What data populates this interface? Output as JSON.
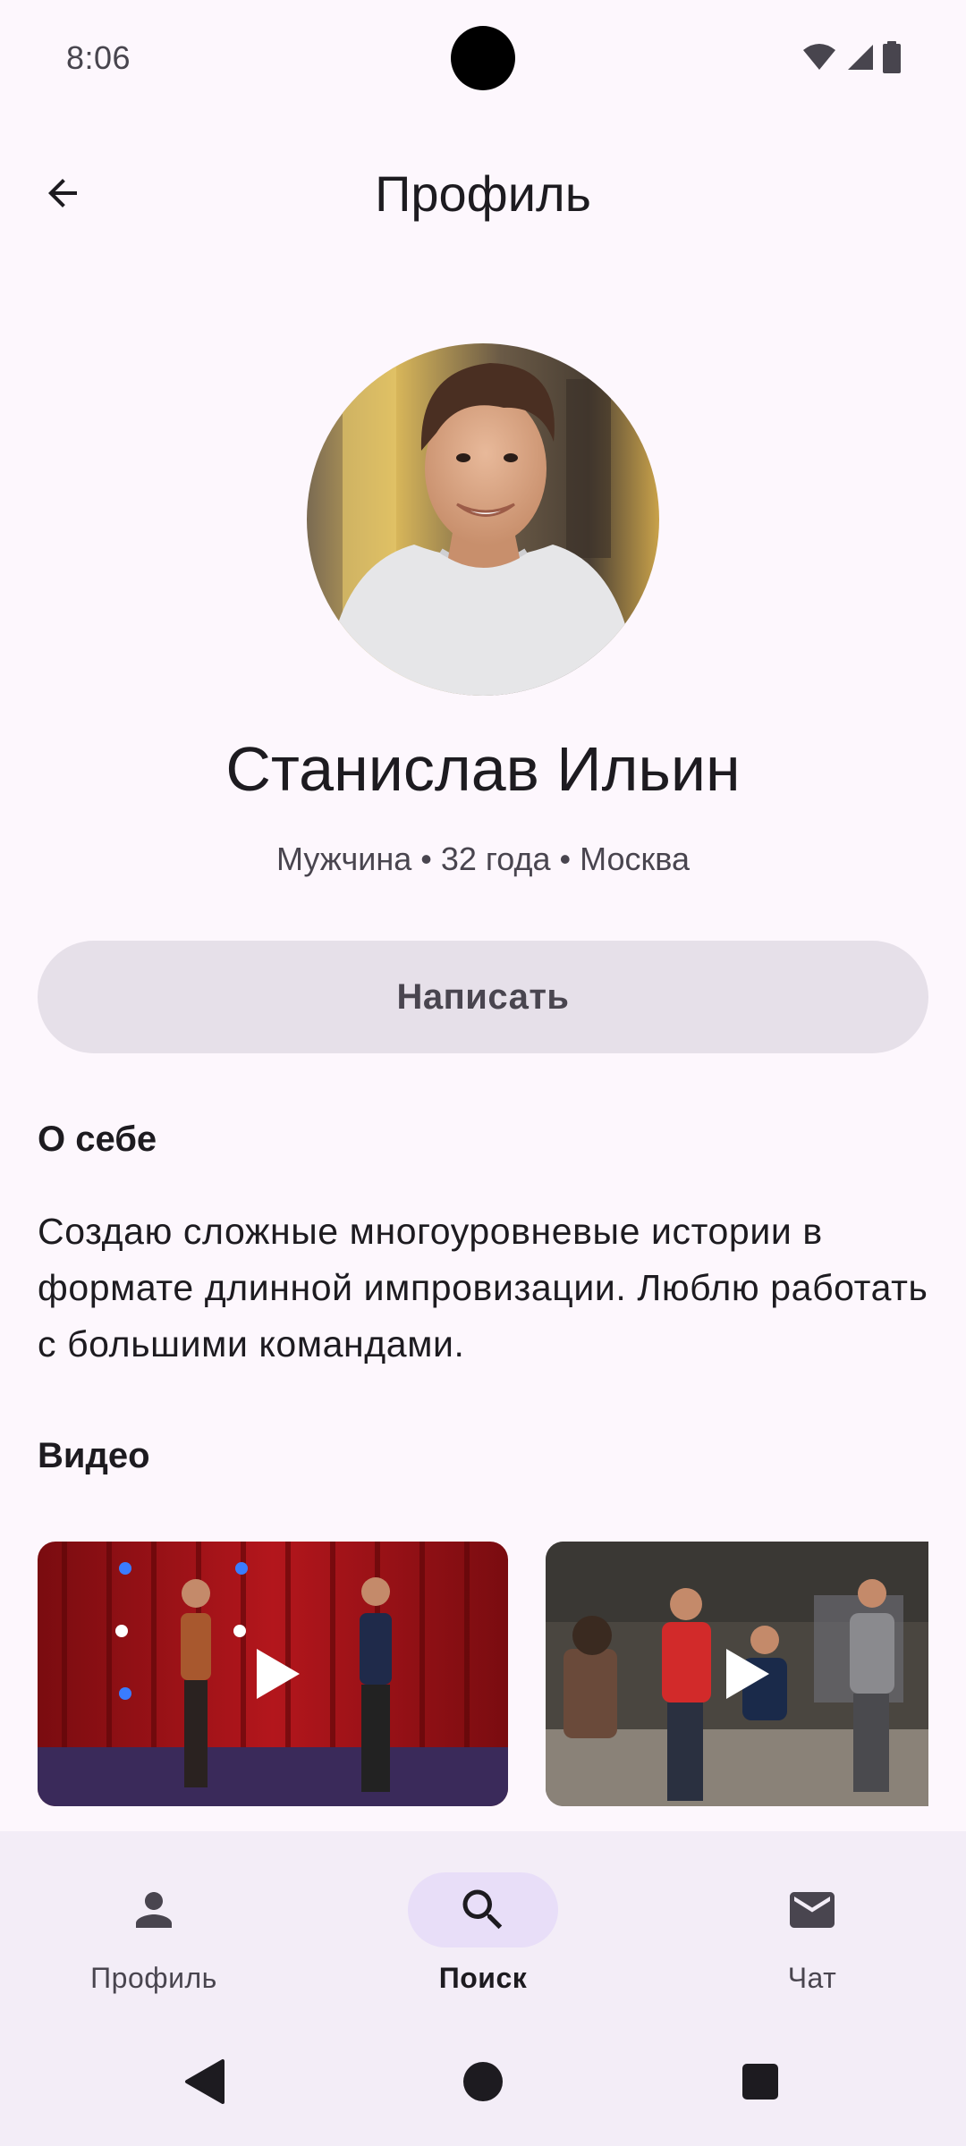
{
  "status_bar": {
    "time": "8:06"
  },
  "top_bar": {
    "title": "Профиль",
    "back_icon": "arrow-back-icon"
  },
  "profile": {
    "name": "Станислав Ильин",
    "meta": "Мужчина • 32 года • Москва",
    "write_button": "Написать"
  },
  "about": {
    "title": "О себе",
    "text": "Создаю сложные многоуровневые истории в формате длинной импровизации. Люблю работать с большими командами."
  },
  "videos": {
    "title": "Видео",
    "items": [
      {
        "icon": "play-icon"
      },
      {
        "icon": "play-icon"
      }
    ]
  },
  "bottom_nav": {
    "items": [
      {
        "label": "Профиль",
        "icon": "person-icon",
        "active": false
      },
      {
        "label": "Поиск",
        "icon": "search-icon",
        "active": true
      },
      {
        "label": "Чат",
        "icon": "mail-icon",
        "active": false
      }
    ]
  },
  "colors": {
    "background": "#FDF7FD",
    "nav_background": "#F3EDF7",
    "active_indicator": "#E8DEF8",
    "button_background": "#E6E0E9",
    "text_primary": "#1D1B20",
    "text_secondary": "#49454F"
  }
}
